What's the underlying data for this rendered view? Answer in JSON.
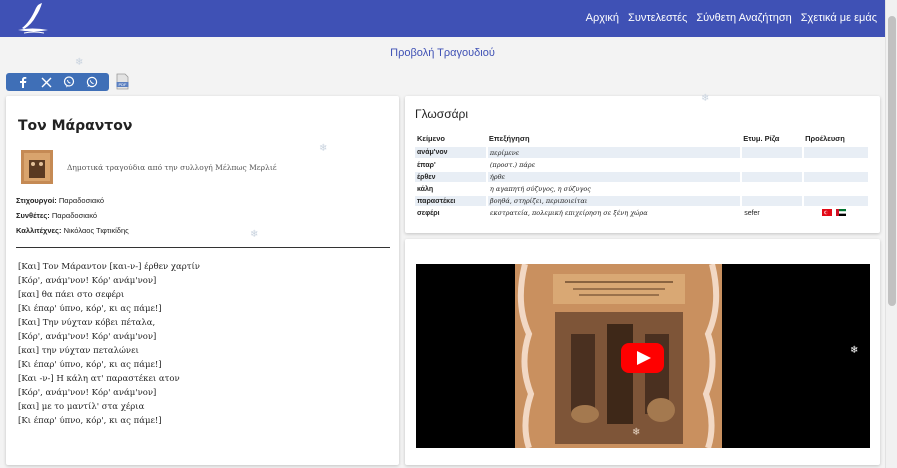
{
  "nav": {
    "links": [
      "Αρχική",
      "Συντελεστές",
      "Σύνθετη Αναζήτηση",
      "Σχετικά με εμάς"
    ]
  },
  "page_title": "Προβολή Τραγουδιού",
  "share": {
    "icons": [
      "facebook-icon",
      "x-icon",
      "viber-icon",
      "whatsapp-icon"
    ],
    "pdf_label": "PDF"
  },
  "song": {
    "title": "Τον Μάραντον",
    "collection": "Δημοτικά τραγούδια από την συλλογή Μέλπως Μερλιέ",
    "lyricists_label": "Στιχουργοί:",
    "lyricists": "Παραδοσιακό",
    "composers_label": "Συνθέτες:",
    "composers": "Παραδοσιακό",
    "artists_label": "Καλλιτέχνες:",
    "artists": "Νικόλαος Τιφτικίδης",
    "lyrics": [
      "[Και] Τον Μάραντον [και-ν-] έρθεν χαρτίν",
      "[Κόρ', ανάμ'νον! Κόρ' ανάμ'νον]",
      "[και] θα πάει στο σεφέρι",
      "[Κι έπαρ' ύπνο, κόρ', κι ας πάμε!]",
      "",
      "[Και] Την νύχταν κόβει πέταλα,",
      "[Κόρ', ανάμ'νον! Κόρ' ανάμ'νον]",
      "[και] την νύχταν πεταλώνει",
      "[Κι έπαρ' ύπνο, κόρ', κι ας πάμε!]",
      "",
      "[Και -ν-] Η κάλη ατ' παραστέκει ατον",
      "[Κόρ', ανάμ'νον! Κόρ' ανάμ'νον]",
      "[και] με το μαντίλ' στα χέρια",
      "[Κι έπαρ' ύπνο, κόρ', κι ας πάμε!]"
    ]
  },
  "glossary": {
    "title": "Γλωσσάρι",
    "headers": [
      "Κείμενο",
      "Επεξήγηση",
      "Ετυμ. Ρίζα",
      "Προέλευση"
    ],
    "rows": [
      {
        "word": "ανάμ'νον",
        "explanation": "περίμενε",
        "root": "",
        "origin": ""
      },
      {
        "word": "έπαρ'",
        "explanation": "(προστ.) πάρε",
        "root": "",
        "origin": ""
      },
      {
        "word": "έρθεν",
        "explanation": "ήρθε",
        "root": "",
        "origin": ""
      },
      {
        "word": "κάλη",
        "explanation": "η αγαπητή σύζυγος, η σύζυγος",
        "root": "",
        "origin": ""
      },
      {
        "word": "παραστέκει",
        "explanation": "βοηθά, στηρίζει, περιποιείται",
        "root": "",
        "origin": ""
      },
      {
        "word": "σεφέρι",
        "explanation": "εκστρατεία, πολεμική επιχείρηση σε ξένη χώρα",
        "root": "sefer",
        "origin": "flags"
      }
    ],
    "origin_flags": [
      "turkey-flag-icon",
      "arabic-flag-icon"
    ]
  },
  "colors": {
    "brand": "#3f51b5",
    "share_bar": "#3f6fb7",
    "row_shade": "#e8eef5",
    "play": "#ff0000"
  }
}
